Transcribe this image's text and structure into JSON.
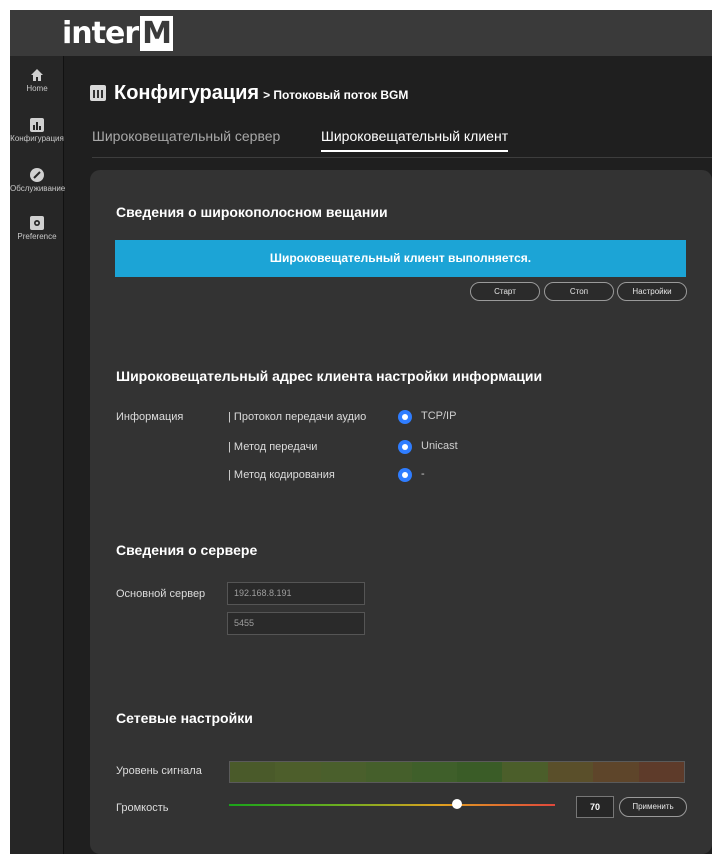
{
  "brand": {
    "logo_main": "inter",
    "logo_accent": "M"
  },
  "sidebar": {
    "items": [
      {
        "label": "Home",
        "icon": "home-icon"
      },
      {
        "label": "Конфигурация",
        "icon": "chart-icon"
      },
      {
        "label": "Обслуживание",
        "icon": "wrench-icon"
      },
      {
        "label": "Preference",
        "icon": "gear-icon"
      }
    ]
  },
  "header": {
    "title": "Конфигурация",
    "breadcrumb": "> Потоковый поток BGM"
  },
  "tabs": [
    {
      "label": "Широковещательный сервер",
      "active": false
    },
    {
      "label": "Широковещательный клиент",
      "active": true
    }
  ],
  "broadcast_info": {
    "title": "Сведения о широкополосном вещании",
    "status": "Широковещательный клиент выполняется.",
    "buttons": {
      "start": "Старт",
      "stop": "Стоп",
      "settings": "Настройки"
    }
  },
  "client_settings": {
    "title": "Широковещательный адрес клиента настройки информации",
    "info_label": "Информация",
    "rows": [
      {
        "label": "| Протокол передачи аудио",
        "value": "TCP/IP"
      },
      {
        "label": "| Метод передачи",
        "value": "Unicast"
      },
      {
        "label": "| Метод кодирования",
        "value": "-"
      }
    ]
  },
  "server_info": {
    "title": "Сведения о сервере",
    "main_server_label": "Основной сервер",
    "ip": "192.168.8.191",
    "port": "5455"
  },
  "network": {
    "title": "Сетевые настройки",
    "signal_label": "Уровень сигнала",
    "volume_label": "Громкость",
    "volume_value": "70",
    "volume_level": 0.7,
    "apply_label": "Применить",
    "meter_colors": [
      "#4a5a2a",
      "#4d5e2b",
      "#4a5f2c",
      "#455f2b",
      "#3f5f2a",
      "#3a5c27",
      "#4b5e2a",
      "#5a4f2a",
      "#5e452a",
      "#5e3b2a"
    ]
  },
  "colors": {
    "accent": "#1ca4d6",
    "radio": "#2f7dff"
  }
}
